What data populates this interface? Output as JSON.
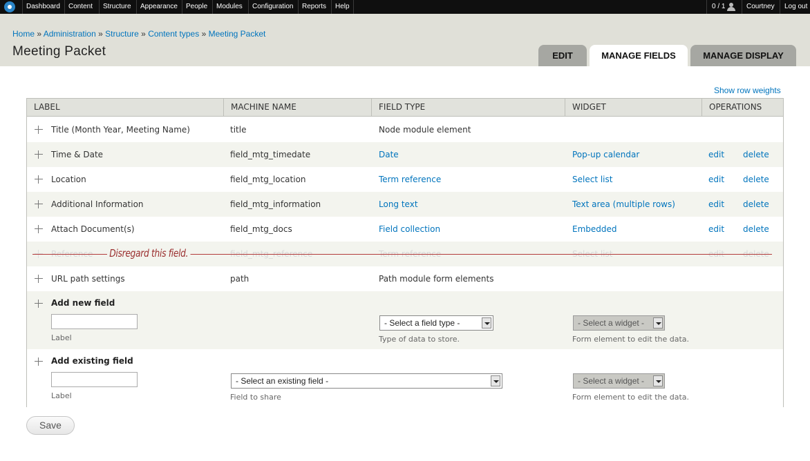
{
  "toolbar": {
    "menu": [
      "Dashboard",
      "Content",
      "Structure",
      "Appearance",
      "People",
      "Modules",
      "Configuration",
      "Reports",
      "Help"
    ],
    "user_count": "0 / 1",
    "username": "Courtney",
    "logout": "Log out"
  },
  "breadcrumb": {
    "items": [
      "Home",
      "Administration",
      "Structure",
      "Content types",
      "Meeting Packet"
    ],
    "separator": "»"
  },
  "page_title": "Meeting Packet",
  "tabs": [
    {
      "label": "EDIT",
      "active": false
    },
    {
      "label": "MANAGE FIELDS",
      "active": true
    },
    {
      "label": "MANAGE DISPLAY",
      "active": false
    }
  ],
  "show_row_weights": "Show row weights",
  "table": {
    "headers": [
      "LABEL",
      "MACHINE NAME",
      "FIELD TYPE",
      "WIDGET",
      "OPERATIONS"
    ],
    "rows": [
      {
        "label": "Title (Month Year, Meeting Name)",
        "machine": "title",
        "type": "Node module element",
        "widget": "",
        "edit": "",
        "delete": ""
      },
      {
        "label": "Time & Date",
        "machine": "field_mtg_timedate",
        "type": "Date",
        "widget": "Pop-up calendar",
        "edit": "edit",
        "delete": "delete"
      },
      {
        "label": "Location",
        "machine": "field_mtg_location",
        "type": "Term reference",
        "widget": "Select list",
        "edit": "edit",
        "delete": "delete"
      },
      {
        "label": "Additional Information",
        "machine": "field_mtg_information",
        "type": "Long text",
        "widget": "Text area (multiple rows)",
        "edit": "edit",
        "delete": "delete"
      },
      {
        "label": "Attach Document(s)",
        "machine": "field_mtg_docs",
        "type": "Field collection",
        "widget": "Embedded",
        "edit": "edit",
        "delete": "delete"
      },
      {
        "label": "Reference",
        "machine": "field_mtg_reference",
        "type": "Term reference",
        "widget": "Select list",
        "edit": "edit",
        "delete": "delete"
      },
      {
        "label": "URL path settings",
        "machine": "path",
        "type": "Path module form elements",
        "widget": "",
        "edit": "",
        "delete": ""
      }
    ],
    "annotation": "Disregard this field."
  },
  "add_new": {
    "title": "Add new field",
    "label_desc": "Label",
    "type_select": "- Select a field type -",
    "type_desc": "Type of data to store.",
    "widget_select": "- Select a widget -",
    "widget_desc": "Form element to edit the data."
  },
  "add_existing": {
    "title": "Add existing field",
    "label_desc": "Label",
    "field_select": "- Select an existing field -",
    "field_desc": "Field to share",
    "widget_select": "- Select a widget -",
    "widget_desc": "Form element to edit the data."
  },
  "save_label": "Save",
  "colors": {
    "link": "#0074bd",
    "toolbar": "#0f0f0f",
    "header": "#e0e0d8",
    "annotation": "#9a2e2e"
  }
}
